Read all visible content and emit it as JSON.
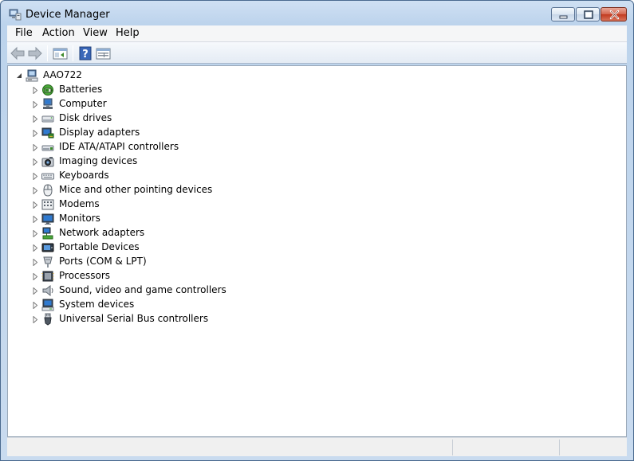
{
  "window": {
    "title": "Device Manager",
    "accent": "#bcd3ec",
    "close_color": "#c1391f"
  },
  "menu": {
    "items": [
      "File",
      "Action",
      "View",
      "Help"
    ]
  },
  "toolbar": {
    "buttons": [
      "back-icon",
      "forward-icon",
      "show-hide-console-tree-icon",
      "help-icon",
      "properties-icon"
    ]
  },
  "tree": {
    "root": {
      "label": "AAO722",
      "icon": "computer-icon",
      "expanded": true
    },
    "items": [
      {
        "label": "Batteries",
        "icon": "battery-icon"
      },
      {
        "label": "Computer",
        "icon": "computer-icon"
      },
      {
        "label": "Disk drives",
        "icon": "disk-drive-icon"
      },
      {
        "label": "Display adapters",
        "icon": "display-adapter-icon"
      },
      {
        "label": "IDE ATA/ATAPI controllers",
        "icon": "ide-controller-icon"
      },
      {
        "label": "Imaging devices",
        "icon": "camera-icon"
      },
      {
        "label": "Keyboards",
        "icon": "keyboard-icon"
      },
      {
        "label": "Mice and other pointing devices",
        "icon": "mouse-icon"
      },
      {
        "label": "Modems",
        "icon": "modem-icon"
      },
      {
        "label": "Monitors",
        "icon": "monitor-icon"
      },
      {
        "label": "Network adapters",
        "icon": "network-adapter-icon"
      },
      {
        "label": "Portable Devices",
        "icon": "portable-device-icon"
      },
      {
        "label": "Ports (COM & LPT)",
        "icon": "port-icon"
      },
      {
        "label": "Processors",
        "icon": "processor-icon"
      },
      {
        "label": "Sound, video and game controllers",
        "icon": "speaker-icon"
      },
      {
        "label": "System devices",
        "icon": "system-device-icon"
      },
      {
        "label": "Universal Serial Bus controllers",
        "icon": "usb-icon"
      }
    ]
  },
  "statusbar": {
    "panes": [
      "",
      "",
      ""
    ]
  }
}
